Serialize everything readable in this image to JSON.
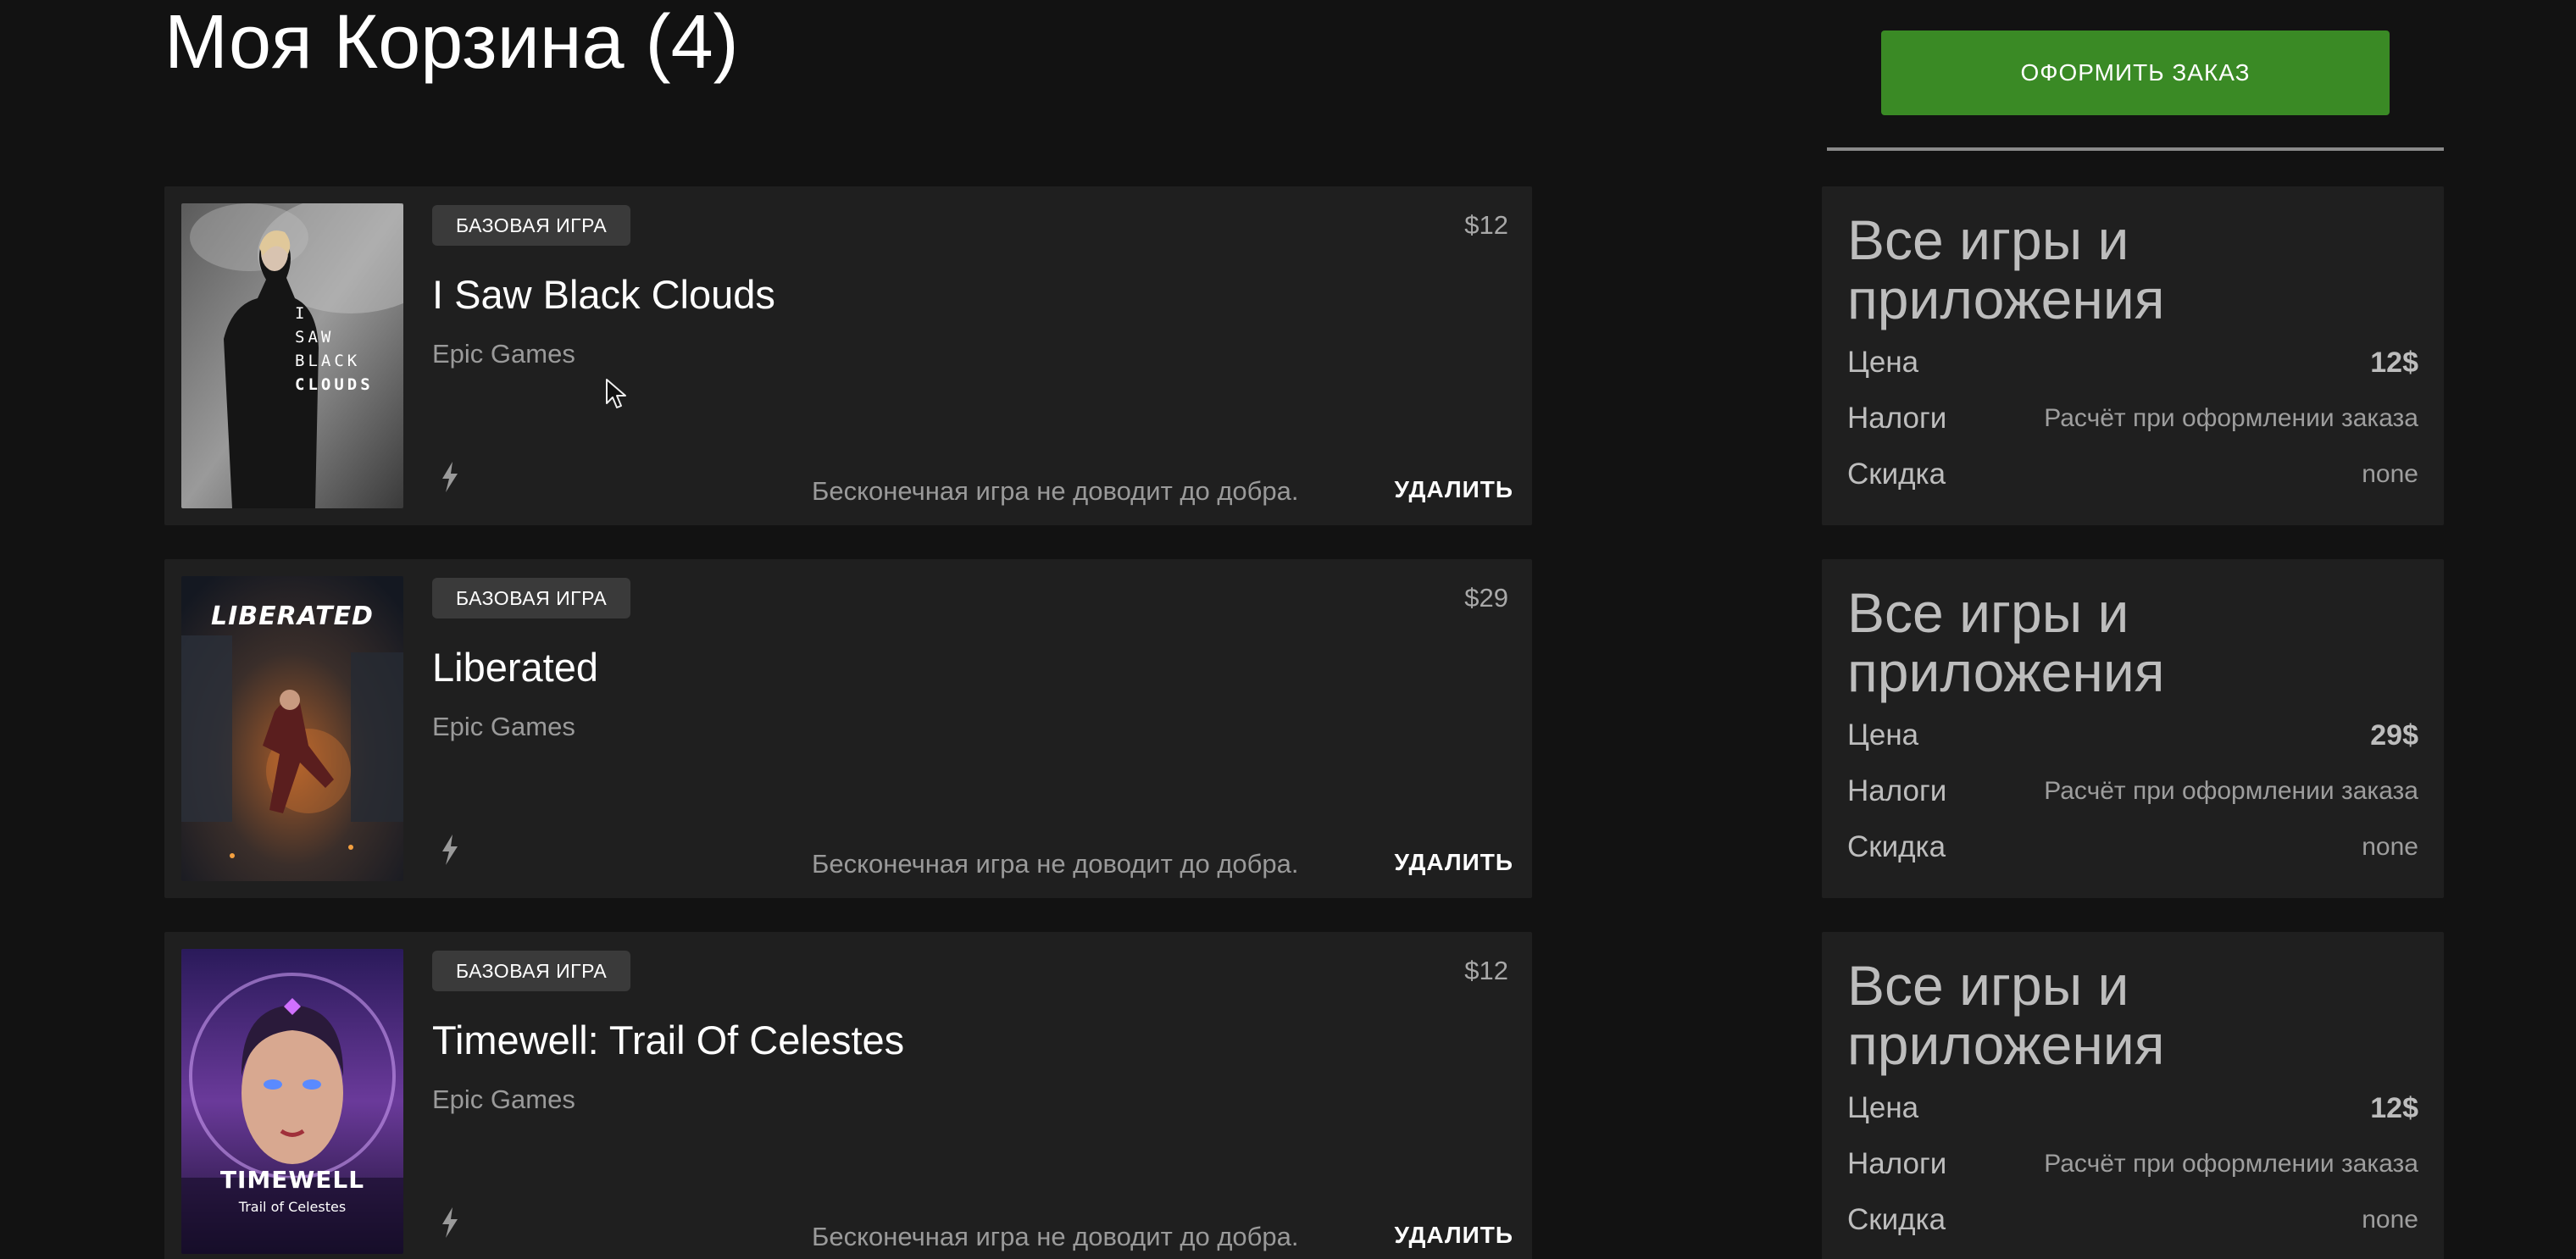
{
  "page": {
    "title": "Моя Корзина (4)"
  },
  "checkout": {
    "label": "ОФОРМИТЬ ЗАКАЗ",
    "color": "#3a8a25"
  },
  "items": [
    {
      "badge": "БАЗОВАЯ ИГРА",
      "title": "I Saw Black Clouds",
      "publisher": "Epic Games",
      "price": "$12",
      "warning": "Бесконечная игра не доводит до добра.",
      "remove_label": "УДАЛИТЬ",
      "cover_lines": [
        "I",
        "SAW",
        "BLACK",
        "CLOUDS"
      ]
    },
    {
      "badge": "БАЗОВАЯ ИГРА",
      "title": "Liberated",
      "publisher": "Epic Games",
      "price": "$29",
      "warning": "Бесконечная игра не доводит до добра.",
      "remove_label": "УДАЛИТЬ",
      "cover_lines": [
        "LIBERATED"
      ]
    },
    {
      "badge": "БАЗОВАЯ ИГРА",
      "title": "Timewell: Trail Of Celestes",
      "publisher": "Epic Games",
      "price": "$12",
      "warning": "Бесконечная игра не доводит до добра.",
      "remove_label": "УДАЛИТЬ",
      "cover_lines": [
        "TIMEWELL",
        "Trail of Celestes"
      ]
    }
  ],
  "summaries": [
    {
      "title": "Все игры и приложения",
      "price_label": "Цена",
      "price_value": "12$",
      "tax_label": "Налоги",
      "tax_value": "Расчёт при оформлении заказа",
      "discount_label": "Скидка",
      "discount_value": "none"
    },
    {
      "title": "Все игры и приложения",
      "price_label": "Цена",
      "price_value": "29$",
      "tax_label": "Налоги",
      "tax_value": "Расчёт при оформлении заказа",
      "discount_label": "Скидка",
      "discount_value": "none"
    },
    {
      "title": "Все игры и приложения",
      "price_label": "Цена",
      "price_value": "12$",
      "tax_label": "Налоги",
      "tax_value": "Расчёт при оформлении заказа",
      "discount_label": "Скидка",
      "discount_value": "none"
    }
  ],
  "icons": {
    "item_action": "lightning-bolt-icon",
    "cursor": "mouse-pointer-icon"
  }
}
